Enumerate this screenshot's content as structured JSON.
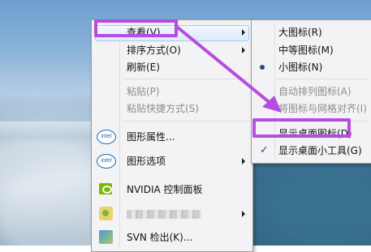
{
  "context_menu": {
    "items": [
      {
        "label": "查看(V)",
        "has_submenu": true
      },
      {
        "label": "排序方式(O)",
        "has_submenu": true
      },
      {
        "label": "刷新(E)"
      },
      {
        "label": "粘贴(P)",
        "disabled": true
      },
      {
        "label": "粘贴快捷方式(S)",
        "disabled": true
      },
      {
        "label": "图形属性...",
        "icon": "intel-icon",
        "icon_text": "intel"
      },
      {
        "label": "图形选项",
        "icon": "intel-icon",
        "icon_text": "intel",
        "has_submenu": true
      },
      {
        "label": "NVIDIA 控制面板",
        "icon": "nvidia-icon"
      },
      {
        "label": "",
        "icon": "tool-icon",
        "has_submenu": true,
        "blurred": true
      },
      {
        "label": "SVN 检出(K)...",
        "icon": "svn-icon"
      }
    ]
  },
  "view_submenu": {
    "items": [
      {
        "label": "大图标(R)"
      },
      {
        "label": "中等图标(M)"
      },
      {
        "label": "小图标(N)",
        "selected": true
      },
      {
        "label": "自动排列图标(A)",
        "disabled": true
      },
      {
        "label": "将图标与网格对齐(I)",
        "disabled": true
      },
      {
        "label": "显示桌面图标(D)"
      },
      {
        "label": "显示桌面小工具(G)",
        "checked": true
      }
    ]
  },
  "annotation": {
    "color": "#b44ee0"
  }
}
